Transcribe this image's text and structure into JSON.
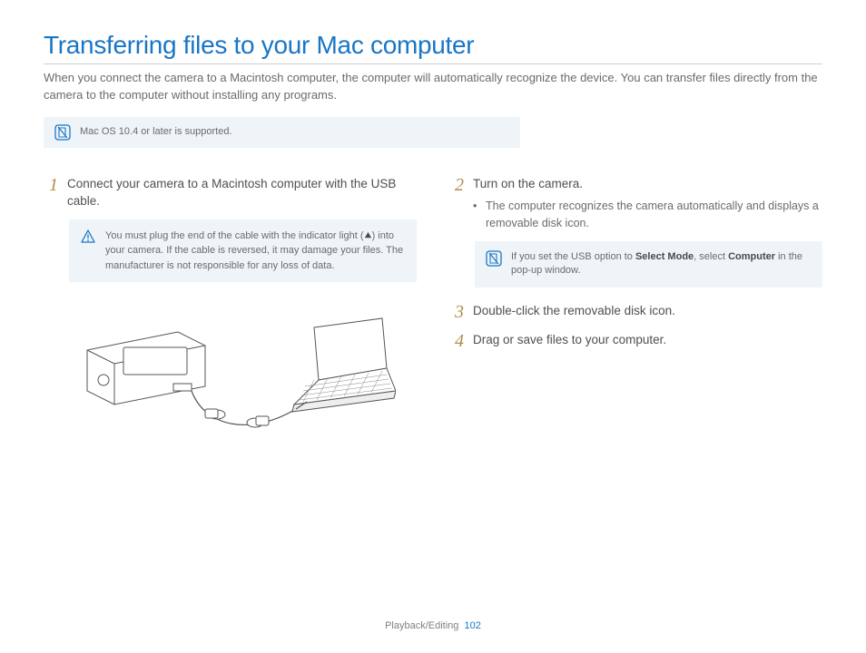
{
  "title": "Transferring files to your Mac computer",
  "intro": "When you connect the camera to a Macintosh computer, the computer will automatically recognize the device. You can transfer files directly from the camera to the computer without installing any programs.",
  "top_note": "Mac OS 10.4 or later is supported.",
  "left": {
    "step1": {
      "num": "1",
      "text": "Connect your camera to a Macintosh computer with the USB cable."
    },
    "warn_pre": "You must plug the end of the cable with the indicator light (",
    "warn_post": ") into your camera. If the cable is reversed, it may damage your files. The manufacturer is not responsible for any loss of data."
  },
  "right": {
    "step2": {
      "num": "2",
      "text": "Turn on the camera.",
      "bullet": "The computer recognizes the camera automatically and displays a removable disk icon."
    },
    "note_pre": "If you set the USB option to ",
    "note_b1": "Select Mode",
    "note_mid": ", select ",
    "note_b2": "Computer",
    "note_post": " in the pop-up window.",
    "step3": {
      "num": "3",
      "text": "Double-click the removable disk icon."
    },
    "step4": {
      "num": "4",
      "text": "Drag or save files to your computer."
    }
  },
  "footer_section": "Playback/Editing",
  "footer_page": "102"
}
